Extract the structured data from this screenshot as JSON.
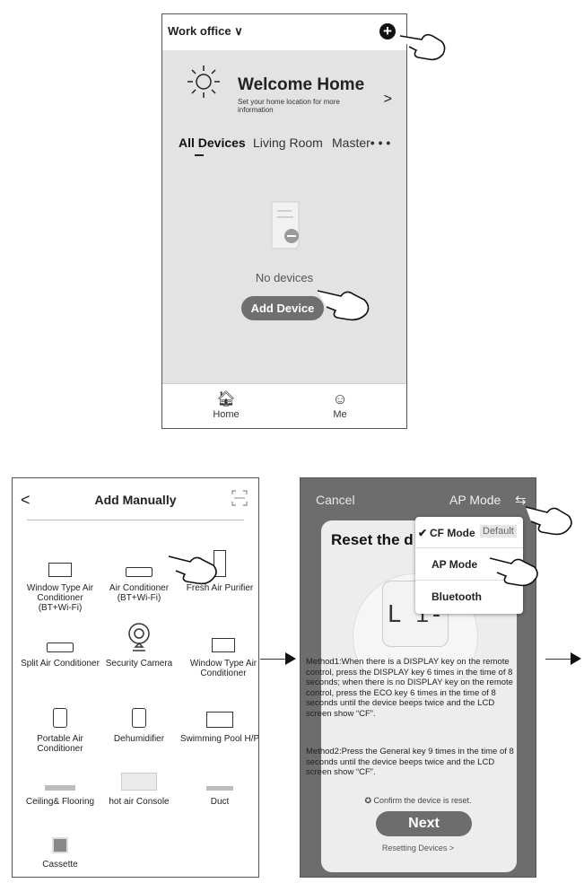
{
  "home_screen": {
    "location": "Work office",
    "welcome_title": "Welcome Home",
    "welcome_subtitle": "Set your home location for more information",
    "welcome_arrow": ">",
    "tabs": [
      "All Devices",
      "Living Room",
      "Master"
    ],
    "tabs_more": "• • •",
    "empty_text": "No devices",
    "add_device": "Add Device",
    "tabbar": [
      {
        "label": "Home",
        "icon": "home-icon"
      },
      {
        "label": "Me",
        "icon": "user-icon"
      }
    ]
  },
  "add_manually_screen": {
    "back": "<",
    "title": "Add Manually",
    "devices": [
      {
        "label": "Window Type Air Conditioner (BT+Wi-Fi)",
        "icon": "window-ac-icon"
      },
      {
        "label": "Air Conditioner (BT+Wi-Fi)",
        "icon": "split-ac-icon"
      },
      {
        "label": "Fresh Air Purifier",
        "icon": "purifier-icon"
      },
      {
        "label": "Split Air Conditioner",
        "icon": "split-ac-icon"
      },
      {
        "label": "Security Camera",
        "icon": "camera-icon"
      },
      {
        "label": "Window Type Air Conditioner",
        "icon": "window-ac-icon"
      },
      {
        "label": "Portable Air Conditioner",
        "icon": "portable-ac-icon"
      },
      {
        "label": "Dehumidifier",
        "icon": "dehumidifier-icon"
      },
      {
        "label": "Swimming Pool H/P",
        "icon": "pool-hp-icon"
      },
      {
        "label": "Ceiling& Flooring",
        "icon": "ceiling-floor-icon"
      },
      {
        "label": "hot air Console",
        "icon": "console-icon"
      },
      {
        "label": "Duct",
        "icon": "duct-icon"
      },
      {
        "label": "Cassette",
        "icon": "cassette-icon"
      }
    ]
  },
  "ap_mode_screen": {
    "cancel": "Cancel",
    "mode": "AP Mode",
    "swap_icon": "swap-icon",
    "reset_title": "Reset the d",
    "lcd_text": "L i-",
    "method1": "Method1:When there is a DISPLAY key on the remote control, press the DISPLAY key 6 times in the time of 8 seconds; when there is no DISPLAY key on the remote control, press the ECO key 6 times in the time of 8 seconds until the device beeps twice and the LCD screen show “CF”.",
    "method2": "Method2:Press the General key 9 times in the time of 8 seconds until the device beeps twice and the LCD screen show “CF”.",
    "confirm": "Confirm the device is reset.",
    "next": "Next",
    "resetting": "Resetting Devices >",
    "menu": {
      "items": [
        {
          "label": "CF Mode",
          "checked": true,
          "badge": "Default"
        },
        {
          "label": "AP Mode",
          "checked": false,
          "badge": ""
        },
        {
          "label": "Bluetooth",
          "checked": false,
          "badge": ""
        }
      ]
    }
  },
  "colors": {
    "dark_overlay": "#6d6d6d",
    "home_bg": "#e3e3e3",
    "button_gray": "#6f6f6f"
  }
}
